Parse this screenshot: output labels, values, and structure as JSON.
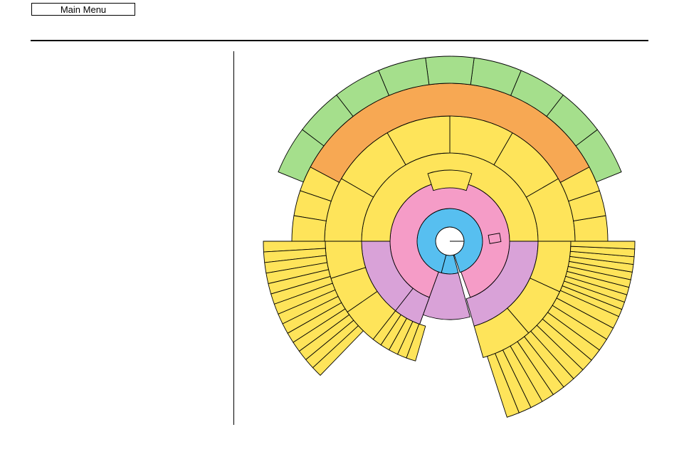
{
  "toolbar": {
    "main_menu_label": "Main Menu"
  },
  "colors": {
    "blue": "#57bff0",
    "pink": "#f59cc7",
    "purple": "#d9a2d8",
    "yellow": "#fee45a",
    "orange": "#f7a853",
    "green": "#a5df8c",
    "white": "#ffffff"
  },
  "sunburst": {
    "description_levels": 6,
    "segments": [
      {
        "ring": "center",
        "color": "white"
      },
      {
        "ring": "ring1",
        "color": "blue"
      },
      {
        "ring": "ring2",
        "color": "pink"
      },
      {
        "ring": "ring3",
        "color": "purple"
      },
      {
        "ring": "ring3",
        "color": "yellow"
      },
      {
        "ring": "ring4",
        "color": "orange"
      },
      {
        "ring": "ring5",
        "color": "green"
      }
    ]
  }
}
